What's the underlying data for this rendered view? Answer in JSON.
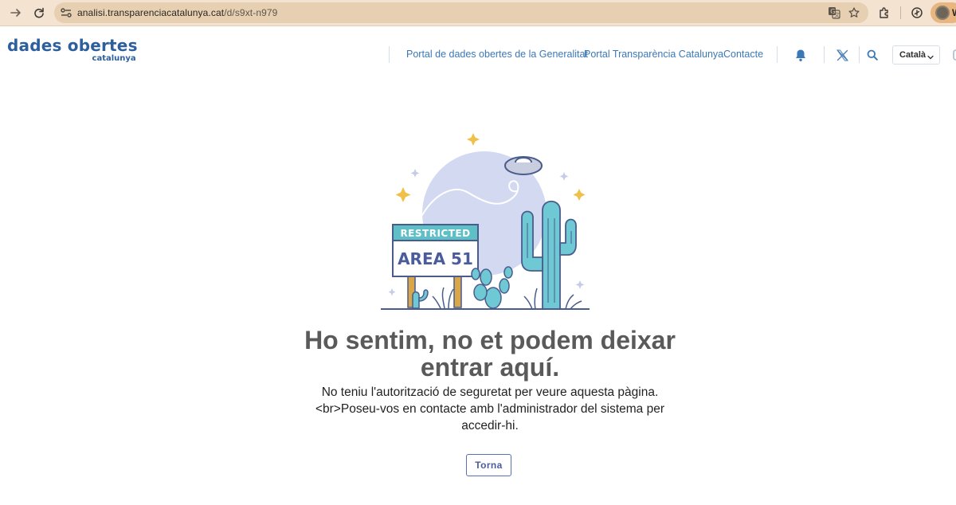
{
  "browser": {
    "url_host": "analisi.transparenciacatalunya.cat",
    "url_path": "/d/s9xt-n979",
    "profile_initial": "W",
    "icons": [
      "back-arrow-icon",
      "reload-icon",
      "site-info-icon",
      "translate-icon",
      "bookmark-star-icon",
      "extensions-icon",
      "sync-icon",
      "profile-avatar"
    ]
  },
  "header": {
    "logo_main": "dades obertes",
    "logo_sub": "catalunya",
    "nav": [
      {
        "label": "Portal de dades obertes de la Generalitat"
      },
      {
        "label": "Portal Transparència Catalunya"
      },
      {
        "label": "Contacte"
      }
    ],
    "icons": [
      "bell-icon",
      "x-logo-icon",
      "search-icon"
    ],
    "language": "Català",
    "accent_color": "#3a78b8",
    "logo_color": "#2d5e9e"
  },
  "illustration": {
    "sign_top": "RESTRICTED",
    "sign_main": "AREA 51"
  },
  "main": {
    "title": "Ho sentim, no et podem deixar entrar aquí.",
    "description": "No teniu l'autorització de seguretat per veure aquesta pàgina. <br>Poseu-vos en contacte amb l'administrador del sistema per accedir-hi.",
    "back_button": "Torna",
    "button_color": "#4a5c9a"
  }
}
